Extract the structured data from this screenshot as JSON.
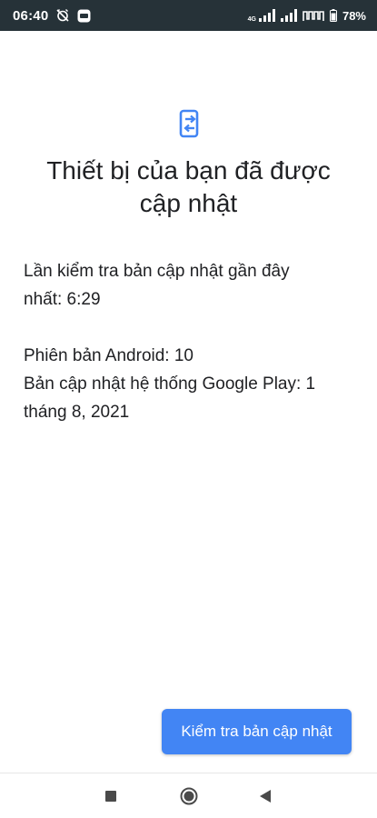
{
  "status_bar": {
    "time": "06:40",
    "network_label": "4G",
    "battery_percent": "78%",
    "icons": [
      "alarm-off-icon",
      "zalo-app-icon",
      "signal-icon",
      "signal-icon",
      "wifi-calling-icon",
      "battery-icon"
    ]
  },
  "main": {
    "icon": "system-update-icon",
    "headline_line1": "Thiết bị của bạn đã được",
    "headline_line2": "cập nhật",
    "last_check_line1": "Lần kiểm tra bản cập nhật gần đây",
    "last_check_line2": "nhất: 6:29",
    "android_version": "Phiên bản Android: 10",
    "play_update_line1": "Bản cập nhật hệ thống Google Play: 1",
    "play_update_line2": "tháng 8, 2021"
  },
  "actions": {
    "check_update_label": "Kiểm tra bản cập nhật"
  },
  "nav": {
    "icons": [
      "recents-icon",
      "home-icon",
      "back-icon"
    ]
  },
  "colors": {
    "status_bar_bg": "#263238",
    "accent": "#4285f4",
    "text": "#202124",
    "button_text": "#ffffff"
  }
}
